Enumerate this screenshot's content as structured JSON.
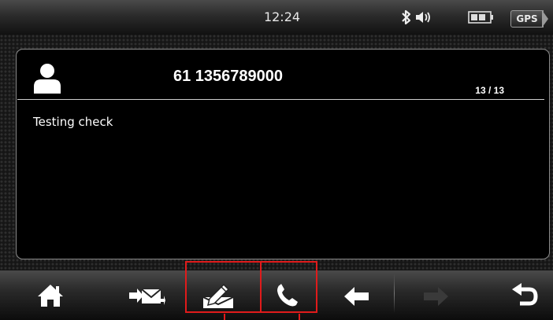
{
  "status_bar": {
    "time": "12:24",
    "gps_label": "GPS",
    "icons": [
      "bluetooth-icon",
      "volume-icon",
      "battery-icon"
    ]
  },
  "message": {
    "contact_icon": "person-icon",
    "phone_number": "61 1356789000",
    "counter": "13 / 13",
    "body": "Testing check"
  },
  "toolbar": {
    "buttons": [
      {
        "name": "home",
        "icon": "home-icon"
      },
      {
        "name": "forward-message",
        "icon": "forward-mail-icon"
      },
      {
        "name": "reply-edit",
        "icon": "edit-message-icon",
        "highlighted": true
      },
      {
        "name": "call-back",
        "icon": "phone-icon",
        "highlighted": true
      },
      {
        "name": "previous",
        "icon": "arrow-left-icon"
      },
      {
        "name": "next",
        "icon": "arrow-right-icon",
        "disabled": true
      },
      {
        "name": "back",
        "icon": "return-icon"
      }
    ]
  },
  "colors": {
    "highlight": "#e01b1b",
    "panel_background": "#000000",
    "text": "#ffffff"
  }
}
